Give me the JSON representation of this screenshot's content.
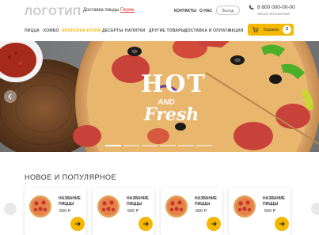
{
  "header": {
    "logo": "ЛОГОТИП",
    "delivery_text": "Доставка пиццы ",
    "delivery_city": "Пермь",
    "links": [
      "КОНТАКТЫ",
      "О НАС"
    ],
    "login_label": "Выход",
    "phone": "8 800 000-00-00",
    "phone_note": "Звонок бесплатный"
  },
  "nav": {
    "items": [
      "ПИЦЦА",
      "КОМБО",
      "ЯПОНСКАЯ КУХНЯ",
      "ДЕСЕРТЫ",
      "НАПИТКИ",
      "ДРУГИЕ ТОВАРЫ",
      "ДОСТАВКА И ОПЛАТА",
      "АКЦИИ"
    ],
    "active_index": 2
  },
  "cart": {
    "label": "Корзина",
    "count": "2"
  },
  "hero": {
    "line1": "HOT",
    "line2": "AND",
    "line3": "Fresh",
    "slides": 6,
    "active_slide": 0
  },
  "section": {
    "title": "НОВОЕ И ПОПУЛЯРНОЕ"
  },
  "products": [
    {
      "name_line1": "НАЗВАНИЕ",
      "name_line2": "ПИЦЦЫ",
      "price": "600 Р"
    },
    {
      "name_line1": "НАЗВАНИЕ",
      "name_line2": "ПИЦЦЫ",
      "price": "600 Р"
    },
    {
      "name_line1": "НАЗВАНИЕ",
      "name_line2": "ПИЦЦЫ",
      "price": "600 Р"
    },
    {
      "name_line1": "НАЗВАНИЕ",
      "name_line2": "ПИЦЦЫ",
      "price": "600 Р"
    }
  ],
  "colors": {
    "accent": "#f5b800",
    "city": "#e53935",
    "text": "#333333"
  }
}
